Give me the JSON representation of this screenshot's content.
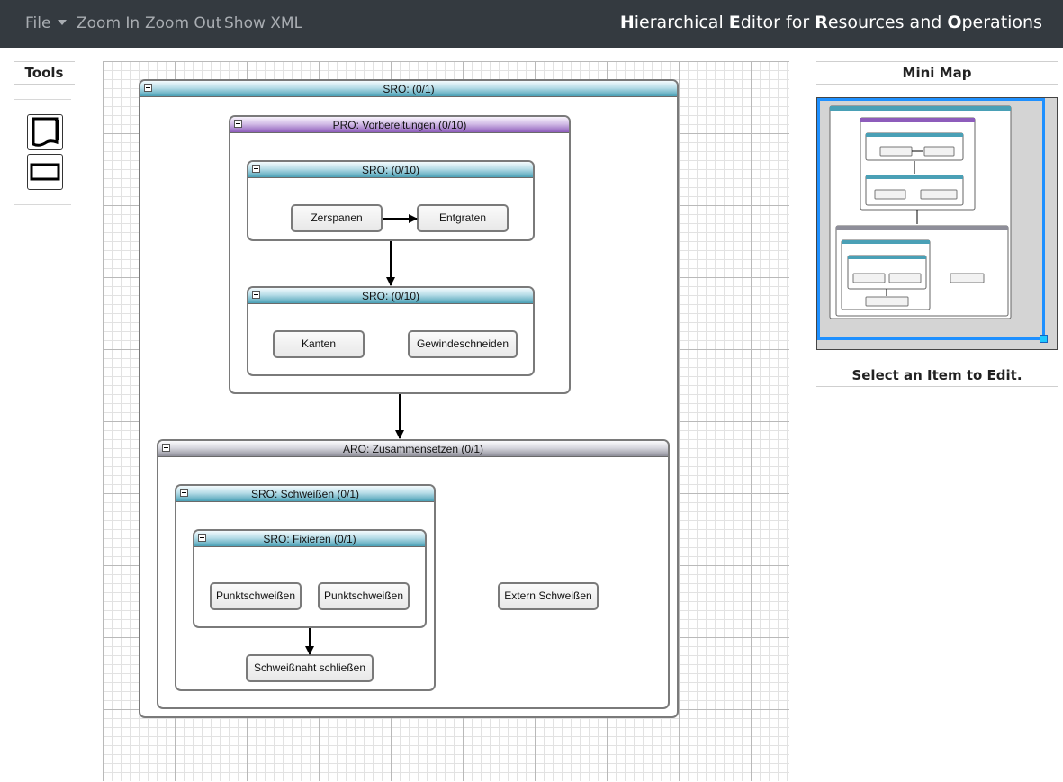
{
  "navbar": {
    "file_label": "File",
    "zoom_in_label": "Zoom In",
    "zoom_out_label": "Zoom Out",
    "show_xml_label": "Show XML",
    "brand": [
      {
        "initial": "H",
        "rest": "ierarchical "
      },
      {
        "initial": "E",
        "rest": "ditor for "
      },
      {
        "initial": "R",
        "rest": "esources and "
      },
      {
        "initial": "O",
        "rest": "perations"
      }
    ]
  },
  "tools": {
    "title": "Tools",
    "items": [
      {
        "icon": "document-shape-icon"
      },
      {
        "icon": "rectangle-shape-icon"
      }
    ]
  },
  "diagram": {
    "groups": {
      "sro_root": "SRO: (0/1)",
      "pro_vorbereitungen": "PRO: Vorbereitungen (0/10)",
      "sro_a": "SRO: (0/10)",
      "sro_b": "SRO: (0/10)",
      "aro_zusammensetzen": "ARO: Zusammensetzen (0/1)",
      "sro_schweissen": "SRO: Schweißen (0/1)",
      "sro_fixieren": "SRO: Fixieren (0/1)"
    },
    "nodes": {
      "zerspanen": "Zerspanen",
      "entgraten": "Entgraten",
      "kanten": "Kanten",
      "gewindeschneiden": "Gewindeschneiden",
      "punktschweissen_1": "Punktschweißen",
      "punktschweissen_2": "Punktschweißen",
      "schweissnaht": "Schweißnaht schließen",
      "extern_schweissen": "Extern Schweißen"
    },
    "colors": {
      "sro_header": "#4aa0b6",
      "pro_header": "#8d5cbb",
      "aro_header": "#8e8e99",
      "edge": "#000000"
    }
  },
  "minimap": {
    "title": "Mini Map",
    "viewport_color": "#1e90ff"
  },
  "editor": {
    "prompt": "Select an Item to Edit."
  }
}
